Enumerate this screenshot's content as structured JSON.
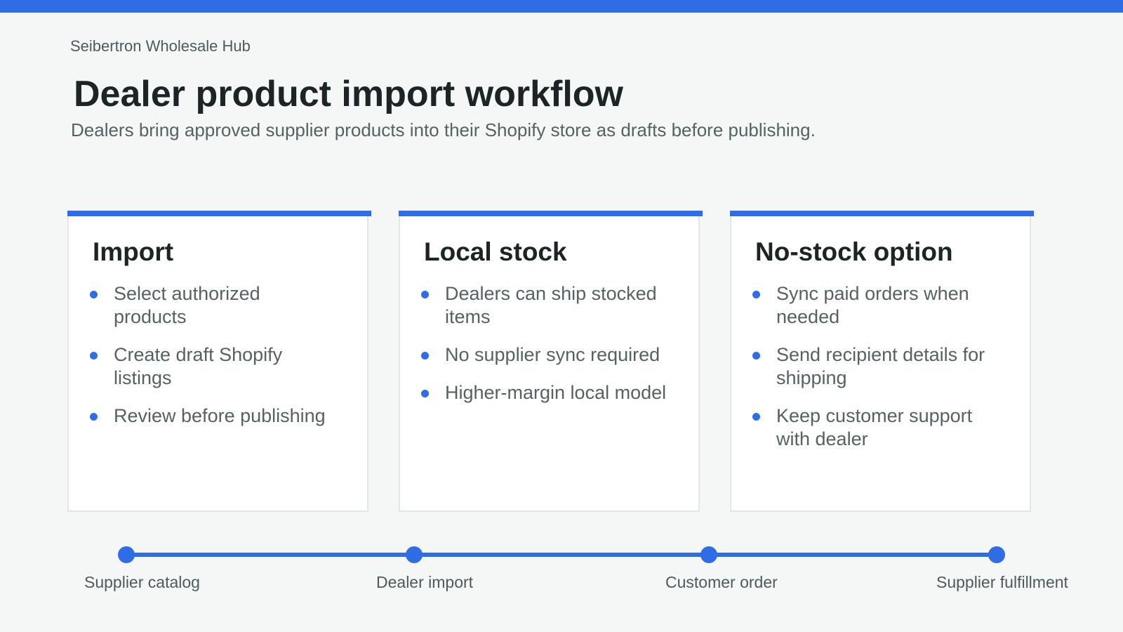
{
  "colors": {
    "accent": "#2f6de6",
    "background": "#f5f7f7",
    "card_background": "#ffffff",
    "heading_text": "#1c2426",
    "body_text": "#556264"
  },
  "header": {
    "brand": "Seibertron Wholesale Hub",
    "title": "Dealer product import workflow",
    "subtitle": "Dealers bring approved supplier products into their Shopify store as drafts before publishing."
  },
  "cards": [
    {
      "title": "Import",
      "bullets": [
        "Select authorized products",
        "Create draft Shopify listings",
        "Review before publishing"
      ]
    },
    {
      "title": "Local stock",
      "bullets": [
        "Dealers can ship stocked items",
        "No supplier sync required",
        "Higher-margin local model"
      ]
    },
    {
      "title": "No-stock option",
      "bullets": [
        "Sync paid orders when needed",
        "Send recipient details for shipping",
        "Keep customer support with dealer"
      ]
    }
  ],
  "timeline": {
    "steps": [
      "Supplier catalog",
      "Dealer import",
      "Customer order",
      "Supplier fulfillment"
    ]
  }
}
